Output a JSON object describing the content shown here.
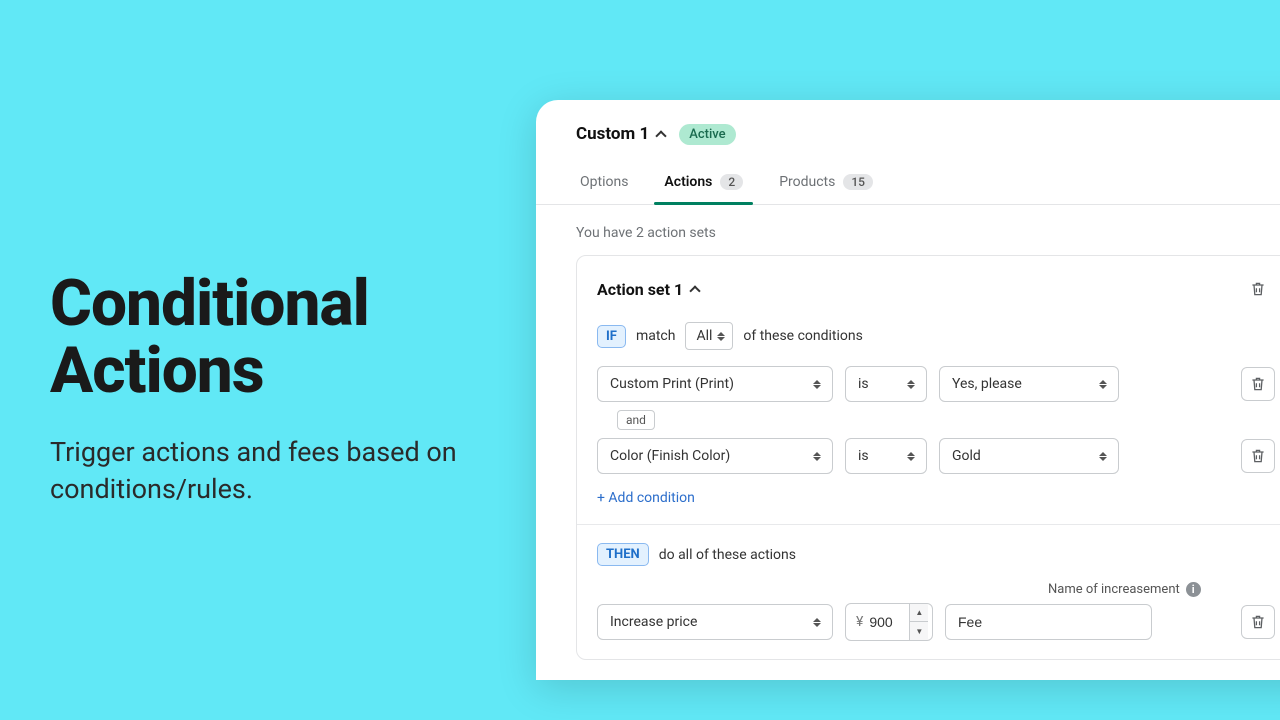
{
  "hero": {
    "title_line1": "Conditional",
    "title_line2": "Actions",
    "subtitle": "Trigger actions and fees based on conditions/rules."
  },
  "header": {
    "title": "Custom 1",
    "status": "Active"
  },
  "tabs": {
    "options": "Options",
    "actions": "Actions",
    "actions_count": "2",
    "products": "Products",
    "products_count": "15"
  },
  "summary": "You have 2 action sets",
  "action_set": {
    "title": "Action set 1",
    "if_label": "IF",
    "match_text": "match",
    "match_scope": "All",
    "conditions_suffix": "of these conditions",
    "and_label": "and",
    "add_condition": "+ Add condition",
    "then_label": "THEN",
    "then_suffix": "do all of these actions",
    "name_label": "Name of increasement"
  },
  "conditions": {
    "0": {
      "field": "Custom Print (Print)",
      "op": "is",
      "value": "Yes, please"
    },
    "1": {
      "field": "Color (Finish Color)",
      "op": "is",
      "value": "Gold"
    }
  },
  "actions": {
    "0": {
      "type": "Increase price",
      "currency": "¥",
      "amount": "900",
      "name": "Fee"
    }
  }
}
